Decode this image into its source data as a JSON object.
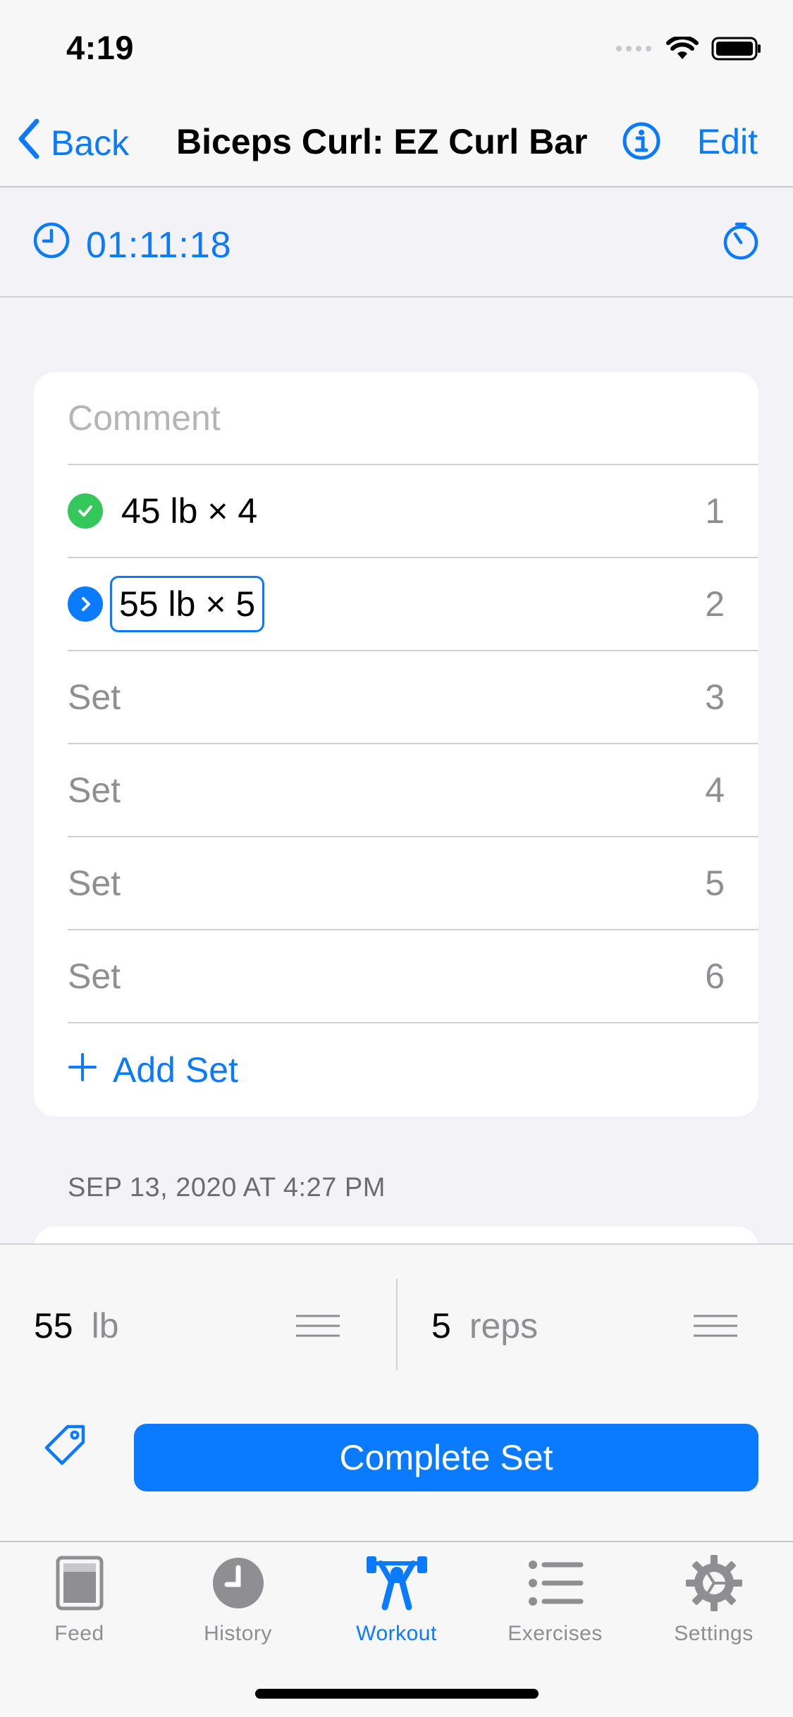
{
  "status_bar": {
    "time": "4:19"
  },
  "nav": {
    "back_label": "Back",
    "title": "Biceps Curl: EZ Curl Bar",
    "edit_label": "Edit"
  },
  "timer": {
    "elapsed": "01:11:18"
  },
  "card": {
    "comment_placeholder": "Comment",
    "sets": [
      {
        "label": "45 lb × 4",
        "number": "1",
        "state": "completed"
      },
      {
        "label": "55 lb × 5",
        "number": "2",
        "state": "current"
      },
      {
        "label": "Set",
        "number": "3",
        "state": "empty"
      },
      {
        "label": "Set",
        "number": "4",
        "state": "empty"
      },
      {
        "label": "Set",
        "number": "5",
        "state": "empty"
      },
      {
        "label": "Set",
        "number": "6",
        "state": "empty"
      }
    ],
    "add_set_label": "Add Set"
  },
  "section": {
    "date_header": "SEP 13, 2020 AT 4:27 PM"
  },
  "entry": {
    "weight_value": "55",
    "weight_unit": "lb",
    "reps_value": "5",
    "reps_unit": "reps",
    "complete_label": "Complete Set"
  },
  "tabs": [
    {
      "label": "Feed",
      "icon": "feed-icon",
      "active": false
    },
    {
      "label": "History",
      "icon": "clock-icon",
      "active": false
    },
    {
      "label": "Workout",
      "icon": "weightlifter-icon",
      "active": true
    },
    {
      "label": "Exercises",
      "icon": "list-icon",
      "active": false
    },
    {
      "label": "Settings",
      "icon": "gear-icon",
      "active": false
    }
  ],
  "colors": {
    "accent": "#0a7aff",
    "success": "#34c759",
    "background": "#f2f2f7"
  }
}
